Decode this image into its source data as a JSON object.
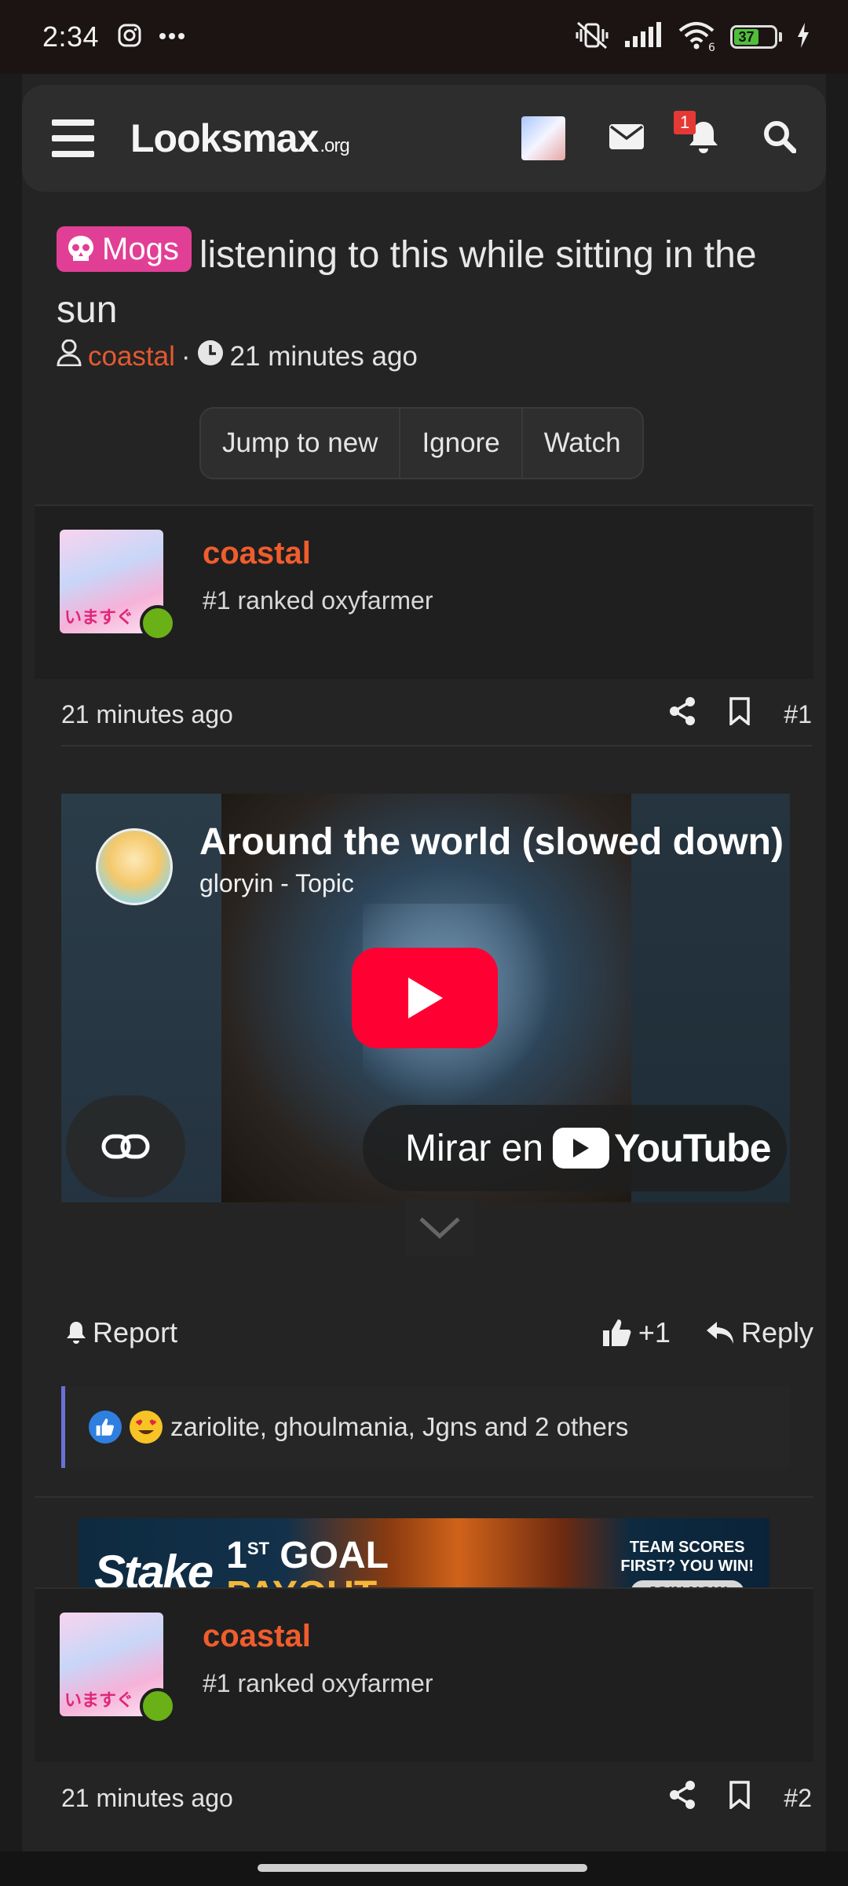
{
  "status": {
    "time": "2:34",
    "battery": "37"
  },
  "nav": {
    "logo_main": "Looksmax",
    "logo_suffix": ".org",
    "notification_count": "1"
  },
  "thread": {
    "prefix": "Mogs",
    "title": "listening to this while sitting in the sun",
    "author": "coastal",
    "separator": "·",
    "time": "21 minutes ago",
    "buttons": [
      "Jump to new",
      "Ignore",
      "Watch"
    ]
  },
  "posts": [
    {
      "username": "coastal",
      "user_title": "#1 ranked oxyfarmer",
      "time": "21 minutes ago",
      "number": "#1"
    },
    {
      "username": "coastal",
      "user_title": "#1 ranked oxyfarmer",
      "time": "21 minutes ago",
      "number": "#2"
    }
  ],
  "video": {
    "title": "Around the world (slowed down)",
    "channel": "gloryin - Topic",
    "watch_label": "Mirar en",
    "yt_label": "YouTube"
  },
  "actions": {
    "report": "Report",
    "like": "+1",
    "reply": "Reply"
  },
  "reactions": {
    "text": "zariolite, ghoulmania, Jgns and 2 others"
  },
  "ad": {
    "brand": "Stake",
    "line1_a": "1",
    "line1_sup": "ST",
    "line1_b": " GOAL",
    "line2": "PAYOUT",
    "right_line1": "TEAM SCORES",
    "right_line2": "FIRST? YOU WIN!",
    "cta": "JOIN NOW"
  },
  "colors": {
    "accent_orange": "#f05d2d",
    "prefix_pink": "#e13f95",
    "youtube_red": "#ff0033",
    "online_green": "#6ab117"
  }
}
